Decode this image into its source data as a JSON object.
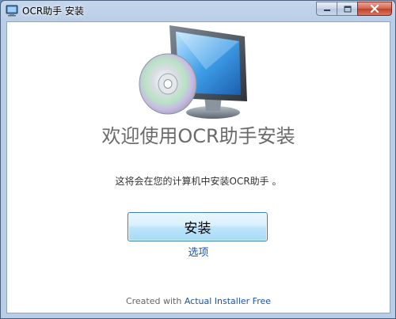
{
  "window": {
    "title": "OCR助手 安装",
    "app_icon": "installer-icon"
  },
  "caption_buttons": {
    "minimize_icon": "minimize-icon",
    "maximize_icon": "maximize-icon",
    "close_icon": "close-icon"
  },
  "main": {
    "hero_icon": "computer-cd-icon",
    "welcome_title": "欢迎使用OCR助手安装",
    "description": "这将会在您的计算机中安装OCR助手 。",
    "install_button_label": "安装",
    "options_link": "选项"
  },
  "footer": {
    "prefix": "Created with ",
    "link_text": "Actual Installer Free"
  },
  "colors": {
    "link": "#1a55a8",
    "welcome_text": "#6b6b6b",
    "button_border": "#3c7fb1",
    "close_button": "#c0402a"
  }
}
